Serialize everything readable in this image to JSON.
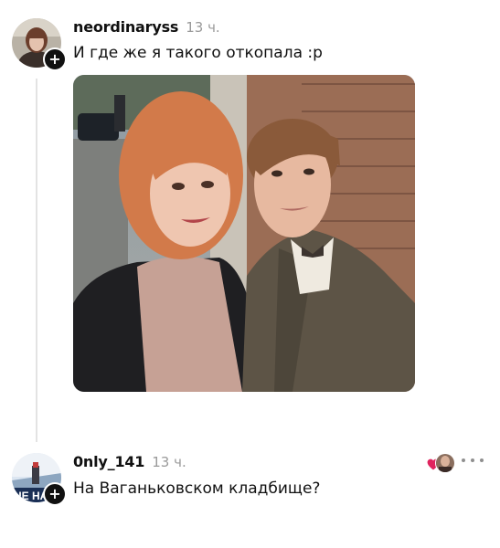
{
  "comments": [
    {
      "username": "neordinaryss",
      "time": "13 ч.",
      "text": "И где же я такого откопала :p",
      "has_photo": true
    },
    {
      "username": "0nly_141",
      "time": "13 ч.",
      "text": "На Ваганьковском кладбище?",
      "avatar_caption": "НЕ НАД"
    }
  ],
  "icons": {
    "follow": "plus-icon",
    "like": "heart-icon",
    "more": "more-dots-icon"
  },
  "colors": {
    "heart": "#e0245e",
    "timestamp": "#9a9a9a",
    "thread_line": "#e3e3e3"
  }
}
